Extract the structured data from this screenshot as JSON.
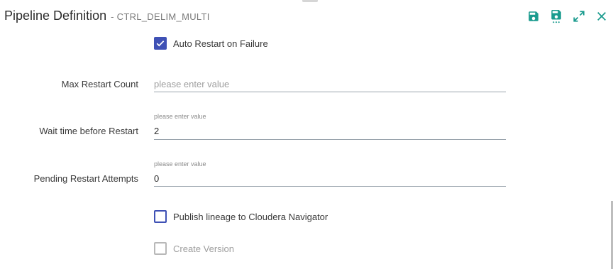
{
  "header": {
    "title": "Pipeline Definition",
    "subtitle": "- CTRL_DELIM_MULTI"
  },
  "toolbar": {
    "icons": [
      "save-icon",
      "save-all-icon",
      "expand-icon",
      "close-icon"
    ],
    "accent_color": "#1a9b8e"
  },
  "form": {
    "auto_restart": {
      "label": "Auto Restart on Failure",
      "checked": true
    },
    "max_restart_count": {
      "label": "Max Restart Count",
      "value": "",
      "placeholder": "please enter value"
    },
    "wait_time": {
      "label": "Wait time before Restart",
      "float_label": "please enter value",
      "value": "2"
    },
    "pending_restart": {
      "label": "Pending Restart Attempts",
      "float_label": "please enter value",
      "value": "0"
    },
    "publish_lineage": {
      "label": "Publish lineage to Cloudera Navigator",
      "checked": false
    },
    "create_version": {
      "label": "Create Version",
      "checked": false,
      "disabled": true
    }
  },
  "colors": {
    "checkbox": "#3f51b5",
    "disabled": "#b8b8b8"
  }
}
